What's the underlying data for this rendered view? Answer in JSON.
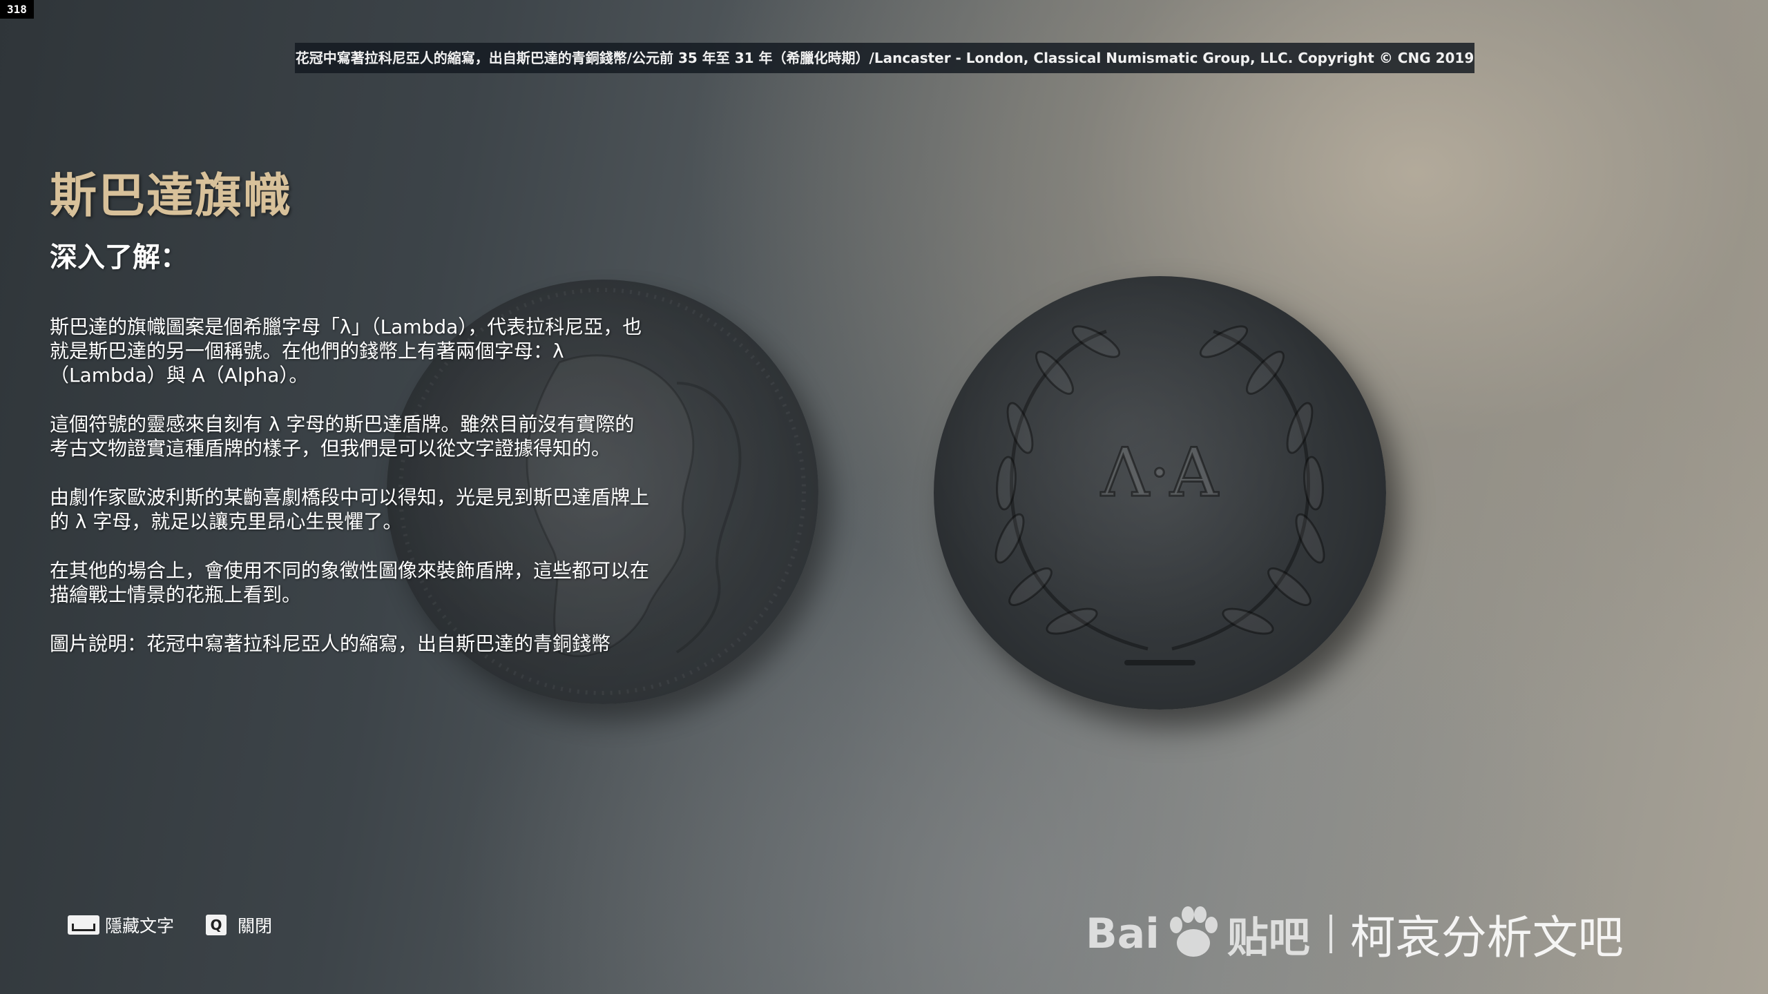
{
  "hud": {
    "frame_counter": "318"
  },
  "caption": "花冠中寫著拉科尼亞人的縮寫，出自斯巴達的青銅錢幣/公元前 35 年至 31 年（希臘化時期）/Lancaster - London, Classical Numismatic Group, LLC. Copyright © CNG 2019",
  "entry": {
    "title": "斯巴達旗幟",
    "subtitle": "深入了解：",
    "paragraphs": [
      "斯巴達的旗幟圖案是個希臘字母「λ」（Lambda），代表拉科尼亞，也就是斯巴達的另一個稱號。在他們的錢幣上有著兩個字母：λ（Lambda）與 A（Alpha）。",
      "這個符號的靈感來自刻有 λ 字母的斯巴達盾牌。雖然目前沒有實際的考古文物證實這種盾牌的樣子，但我們是可以從文字證據得知的。",
      "由劇作家歐波利斯的某齣喜劇橋段中可以得知，光是見到斯巴達盾牌上的 λ 字母，就足以讓克里昂心生畏懼了。",
      "在其他的場合上，會使用不同的象徵性圖像來裝飾盾牌，這些都可以在描繪戰士情景的花瓶上看到。",
      "圖片說明：花冠中寫著拉科尼亞人的縮寫，出自斯巴達的青銅錢幣"
    ]
  },
  "coin": {
    "inscription": "Λ·Α"
  },
  "controls": {
    "hide_text": {
      "key_icon": "spacebar-icon",
      "label": "隱藏文字"
    },
    "close": {
      "key": "Q",
      "label": "關閉"
    }
  },
  "watermark": {
    "brand_prefix": "Bai",
    "brand_suffix": "贴吧",
    "forum": "柯哀分析文吧"
  }
}
